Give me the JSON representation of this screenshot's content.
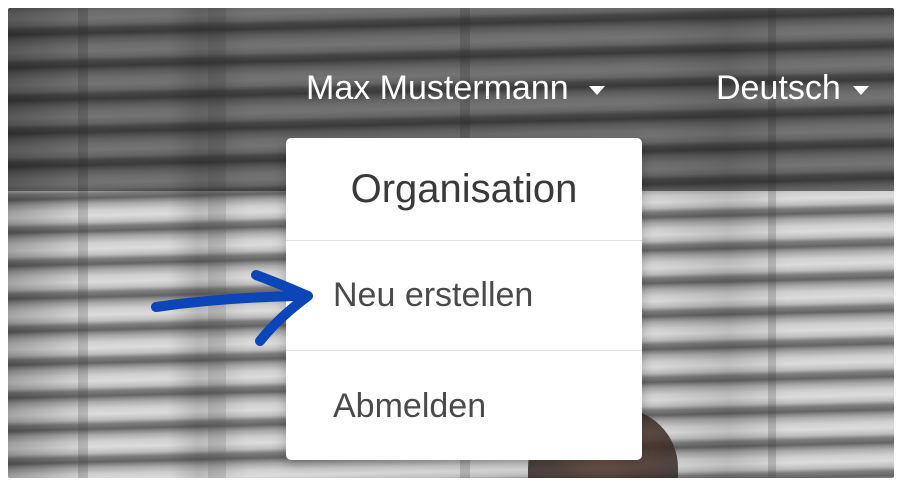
{
  "navbar": {
    "user_menu": {
      "label": "Max Mustermann",
      "icon": "caret-down-icon"
    },
    "language_menu": {
      "label": "Deutsch",
      "icon": "caret-down-icon"
    }
  },
  "dropdown": {
    "header": "Organisation",
    "items": [
      {
        "label": "Neu erstellen"
      },
      {
        "label": "Abmelden"
      }
    ]
  },
  "annotation": {
    "icon": "arrow-right-icon",
    "color": "#0b45b8"
  },
  "colors": {
    "menu_background": "#ffffff",
    "menu_text": "#4a4a4a",
    "nav_text": "#ffffff"
  }
}
